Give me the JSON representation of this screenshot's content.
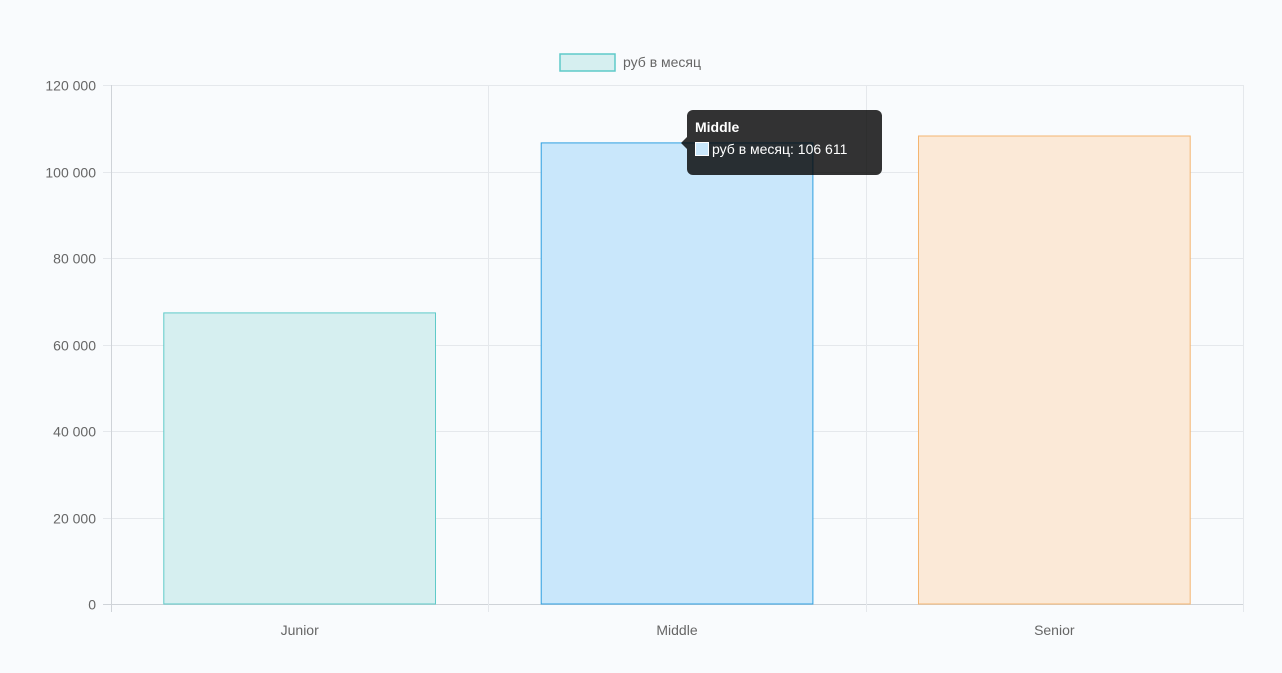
{
  "chart_data": {
    "type": "bar",
    "categories": [
      "Junior",
      "Middle",
      "Senior"
    ],
    "series": [
      {
        "name": "руб в месяц",
        "values": [
          67300,
          106611,
          108200
        ]
      }
    ],
    "bar_fill_colors": [
      "#d6eff0",
      "#c9e7fb",
      "#fbe9d7"
    ],
    "bar_border_colors": [
      "#5fcac9",
      "#2f9fe0",
      "#f4b571"
    ],
    "ylim": [
      0,
      120000
    ],
    "y_ticks": [
      0,
      20000,
      40000,
      60000,
      80000,
      100000,
      120000
    ],
    "y_tick_labels": [
      "0",
      "20 000",
      "40 000",
      "60 000",
      "80 000",
      "100 000",
      "120 000"
    ],
    "grid": true,
    "legend": {
      "position": "top-center",
      "label": "руб в месяц",
      "fill": "#d6eff0",
      "border": "#5fcac9"
    },
    "tooltip": {
      "title": "Middle",
      "label": "руб в месяц: 106 611",
      "swatch": "#c9e7fb"
    }
  }
}
